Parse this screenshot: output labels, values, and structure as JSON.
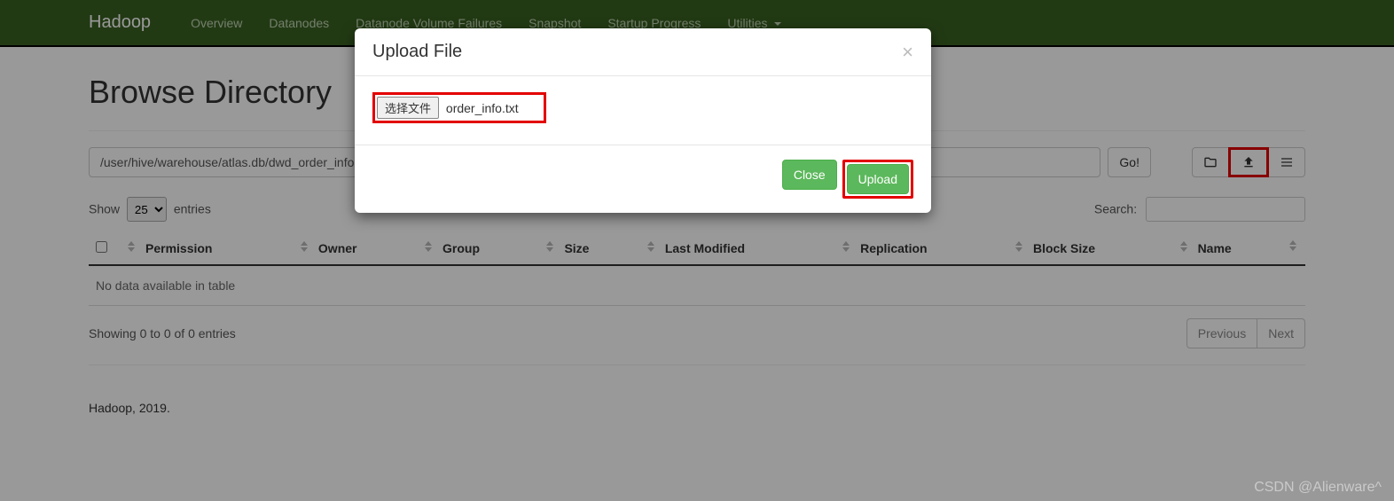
{
  "navbar": {
    "brand": "Hadoop",
    "items": [
      "Overview",
      "Datanodes",
      "Datanode Volume Failures",
      "Snapshot",
      "Startup Progress",
      "Utilities"
    ]
  },
  "page": {
    "title": "Browse Directory",
    "path": "/user/hive/warehouse/atlas.db/dwd_order_info",
    "go": "Go!"
  },
  "table": {
    "show_label_pre": "Show",
    "show_value": "25",
    "show_label_post": "entries",
    "search_label": "Search:",
    "columns": [
      "Permission",
      "Owner",
      "Group",
      "Size",
      "Last Modified",
      "Replication",
      "Block Size",
      "Name"
    ],
    "empty": "No data available in table",
    "info": "Showing 0 to 0 of 0 entries",
    "prev": "Previous",
    "next": "Next"
  },
  "footer": "Hadoop, 2019.",
  "modal": {
    "title": "Upload File",
    "choose_btn": "选择文件",
    "file_name": "order_info.txt",
    "close": "Close",
    "upload": "Upload"
  },
  "watermark": "CSDN @Alienware^"
}
